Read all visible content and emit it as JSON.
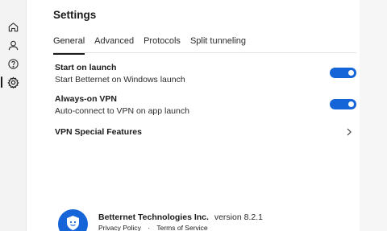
{
  "settings": {
    "title": "Settings",
    "tabs": [
      {
        "label": "General",
        "active": true
      },
      {
        "label": "Advanced",
        "active": false
      },
      {
        "label": "Protocols",
        "active": false
      },
      {
        "label": "Split tunneling",
        "active": false
      }
    ],
    "options": [
      {
        "label": "Start on launch",
        "description": "Start Betternet on Windows launch",
        "enabled": true
      },
      {
        "label": "Always-on VPN",
        "description": "Auto-connect to VPN on app launch",
        "enabled": true
      }
    ],
    "special_features": {
      "label": "VPN Special Features"
    }
  },
  "sidebar": {
    "items": [
      {
        "icon": "home-icon"
      },
      {
        "icon": "user-icon"
      },
      {
        "icon": "help-icon"
      },
      {
        "icon": "gear-icon",
        "active": true
      }
    ]
  },
  "footer": {
    "company": "Betternet Technologies Inc.",
    "version": "version 8.2.1",
    "privacy": "Privacy Policy",
    "separator": "·",
    "terms": "Terms of Service"
  },
  "colors": {
    "accent": "#1565d8",
    "sidebar_bg": "#f3f3f3"
  }
}
